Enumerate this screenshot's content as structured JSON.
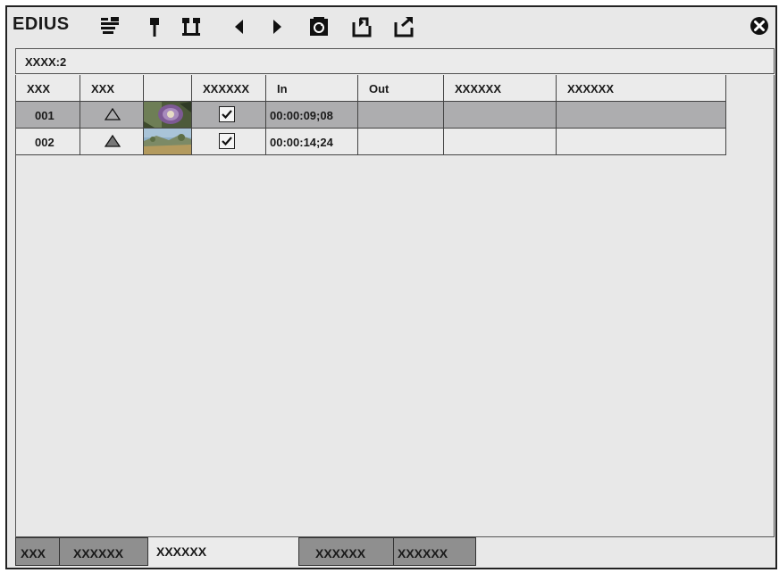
{
  "app": {
    "brand": "EDIUS"
  },
  "toolbar": {
    "icons": [
      "clip-marker-icon",
      "set-marker-icon",
      "marker-in-out-icon",
      "prev-marker-icon",
      "next-marker-icon",
      "sync-icon",
      "import-icon",
      "export-icon"
    ],
    "close_icon": "close-icon"
  },
  "list": {
    "title": "XXXX:2",
    "columns": [
      "XXX",
      "XXX",
      "",
      "XXXXXX",
      "In",
      "Out",
      "XXXXXX",
      "XXXXXX"
    ],
    "rows": [
      {
        "no": "001",
        "marker": "outline-triangle",
        "checked": true,
        "in": "00:00:09;08",
        "out": "",
        "c7": "",
        "c8": "",
        "selected": true
      },
      {
        "no": "002",
        "marker": "filled-triangle",
        "checked": true,
        "in": "00:00:14;24",
        "out": "",
        "c7": "",
        "c8": "",
        "selected": false
      }
    ]
  },
  "tabs": [
    {
      "label": "XXX",
      "active": false
    },
    {
      "label": "XXXXXX",
      "active": false
    },
    {
      "label": "XXXXXX",
      "active": true
    },
    {
      "label": "XXXXXX",
      "active": false
    },
    {
      "label": "XXXXXX",
      "active": false
    }
  ],
  "colors": {
    "selected_row": "#adadaf",
    "inactive_tab": "#8f8f8f",
    "panel_bg": "#e8e8e8"
  }
}
